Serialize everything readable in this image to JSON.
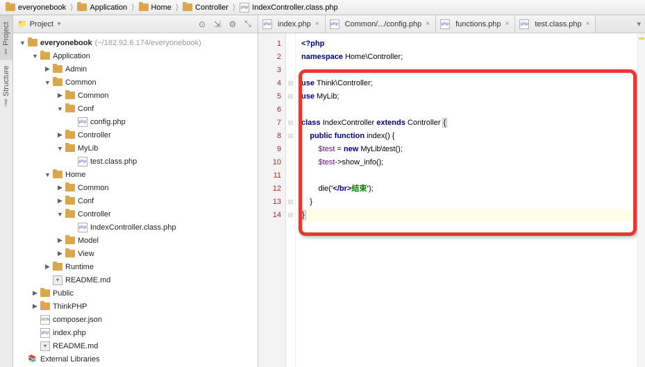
{
  "breadcrumb": [
    {
      "label": "everyonebook",
      "icon": "folder"
    },
    {
      "label": "Application",
      "icon": "folder"
    },
    {
      "label": "Home",
      "icon": "folder"
    },
    {
      "label": "Controller",
      "icon": "folder"
    },
    {
      "label": "IndexController.class.php",
      "icon": "php"
    }
  ],
  "sidebar": {
    "project": {
      "num": "1",
      "label": "Project"
    },
    "structure": {
      "num": "7",
      "label": "Structure"
    }
  },
  "panel": {
    "title": "Project",
    "tools": [
      "target",
      "refresh",
      "gear",
      "collapse"
    ]
  },
  "tree": [
    {
      "d": 0,
      "arrow": "open",
      "icon": "folder",
      "label": "everyonebook",
      "hint": "(~/182.92.6.174/everyonebook)",
      "bold": true
    },
    {
      "d": 1,
      "arrow": "open",
      "icon": "folder",
      "label": "Application"
    },
    {
      "d": 2,
      "arrow": "closed",
      "icon": "folder",
      "label": "Admin"
    },
    {
      "d": 2,
      "arrow": "open",
      "icon": "folder",
      "label": "Common"
    },
    {
      "d": 3,
      "arrow": "closed",
      "icon": "folder",
      "label": "Common"
    },
    {
      "d": 3,
      "arrow": "open",
      "icon": "folder",
      "label": "Conf"
    },
    {
      "d": 4,
      "arrow": "none",
      "icon": "php",
      "label": "config.php"
    },
    {
      "d": 3,
      "arrow": "closed",
      "icon": "folder",
      "label": "Controller"
    },
    {
      "d": 3,
      "arrow": "open",
      "icon": "folder",
      "label": "MyLib"
    },
    {
      "d": 4,
      "arrow": "none",
      "icon": "php",
      "label": "test.class.php"
    },
    {
      "d": 2,
      "arrow": "open",
      "icon": "folder",
      "label": "Home"
    },
    {
      "d": 3,
      "arrow": "closed",
      "icon": "folder",
      "label": "Common"
    },
    {
      "d": 3,
      "arrow": "closed",
      "icon": "folder",
      "label": "Conf"
    },
    {
      "d": 3,
      "arrow": "open",
      "icon": "folder",
      "label": "Controller"
    },
    {
      "d": 4,
      "arrow": "none",
      "icon": "php",
      "label": "IndexController.class.php"
    },
    {
      "d": 3,
      "arrow": "closed",
      "icon": "folder",
      "label": "Model"
    },
    {
      "d": 3,
      "arrow": "closed",
      "icon": "folder",
      "label": "View"
    },
    {
      "d": 2,
      "arrow": "closed",
      "icon": "folder",
      "label": "Runtime"
    },
    {
      "d": 2,
      "arrow": "none",
      "icon": "md",
      "label": "README.md"
    },
    {
      "d": 1,
      "arrow": "closed",
      "icon": "folder",
      "label": "Public"
    },
    {
      "d": 1,
      "arrow": "closed",
      "icon": "folder",
      "label": "ThinkPHP"
    },
    {
      "d": 1,
      "arrow": "none",
      "icon": "json",
      "label": "composer.json"
    },
    {
      "d": 1,
      "arrow": "none",
      "icon": "php",
      "label": "index.php"
    },
    {
      "d": 1,
      "arrow": "none",
      "icon": "md",
      "label": "README.md"
    },
    {
      "d": 0,
      "arrow": "none",
      "icon": "lib",
      "label": "External Libraries"
    }
  ],
  "tabs": [
    {
      "label": "index.php",
      "icon": "php"
    },
    {
      "label": "Common/.../config.php",
      "icon": "php"
    },
    {
      "label": "functions.php",
      "icon": "php"
    },
    {
      "label": "test.class.php",
      "icon": "php"
    }
  ],
  "code": {
    "lines": [
      {
        "n": 1,
        "hl": true,
        "tokens": [
          {
            "t": "<?php",
            "c": "kw"
          }
        ]
      },
      {
        "n": 2,
        "hl": true,
        "tokens": [
          {
            "t": "namespace ",
            "c": "kw"
          },
          {
            "t": "Home\\Controller;",
            "c": ""
          }
        ]
      },
      {
        "n": 3,
        "hl": true,
        "tokens": []
      },
      {
        "n": 4,
        "hl": true,
        "fold": "-",
        "tokens": [
          {
            "t": "use ",
            "c": "kw"
          },
          {
            "t": "Think\\Controller;",
            "c": ""
          }
        ]
      },
      {
        "n": 5,
        "hl": true,
        "fold": "-",
        "tokens": [
          {
            "t": "use ",
            "c": "kw"
          },
          {
            "t": "MyLib;",
            "c": ""
          }
        ]
      },
      {
        "n": 6,
        "hl": true,
        "tokens": []
      },
      {
        "n": 7,
        "hl": true,
        "fold": "-",
        "tokens": [
          {
            "t": "class ",
            "c": "kw"
          },
          {
            "t": "IndexController ",
            "c": ""
          },
          {
            "t": "extends ",
            "c": "kw"
          },
          {
            "t": "Controller ",
            "c": ""
          },
          {
            "t": "{",
            "c": "brace-match"
          }
        ]
      },
      {
        "n": 8,
        "hl": true,
        "fold": "-",
        "tokens": [
          {
            "t": "    ",
            "c": ""
          },
          {
            "t": "public function ",
            "c": "kw"
          },
          {
            "t": "index",
            "c": "fn"
          },
          {
            "t": "() {",
            "c": ""
          }
        ]
      },
      {
        "n": 9,
        "hl": true,
        "tokens": [
          {
            "t": "        ",
            "c": ""
          },
          {
            "t": "$test",
            "c": "var"
          },
          {
            "t": " = ",
            "c": ""
          },
          {
            "t": "new ",
            "c": "kw"
          },
          {
            "t": "MyLib\\test();",
            "c": ""
          }
        ]
      },
      {
        "n": 10,
        "hl": true,
        "tokens": [
          {
            "t": "        ",
            "c": ""
          },
          {
            "t": "$test",
            "c": "var"
          },
          {
            "t": "->show_info();",
            "c": ""
          }
        ]
      },
      {
        "n": 11,
        "hl": true,
        "tokens": []
      },
      {
        "n": 12,
        "hl": true,
        "tokens": [
          {
            "t": "        ",
            "c": ""
          },
          {
            "t": "die",
            "c": ""
          },
          {
            "t": "(",
            "c": ""
          },
          {
            "t": "'",
            "c": "str"
          },
          {
            "t": "</",
            "c": "tag"
          },
          {
            "t": "br",
            "c": "tag"
          },
          {
            "t": ">",
            "c": "tag"
          },
          {
            "t": "结束",
            "c": "str"
          },
          {
            "t": "'",
            "c": "str"
          },
          {
            "t": ");",
            "c": ""
          }
        ]
      },
      {
        "n": 13,
        "hl": true,
        "fold": "-",
        "tokens": [
          {
            "t": "    }",
            "c": ""
          }
        ]
      },
      {
        "n": 14,
        "hl": true,
        "fold": "-",
        "cur": true,
        "tokens": [
          {
            "t": "}",
            "c": "brace-match"
          }
        ]
      }
    ]
  }
}
